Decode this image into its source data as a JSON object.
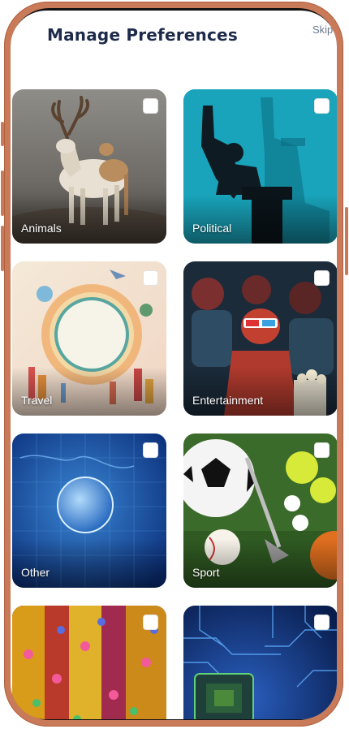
{
  "header": {
    "title": "Manage Preferences",
    "skip_label": "Skip"
  },
  "categories": [
    {
      "label": "Animals",
      "checked": false,
      "icon": "deer-photo"
    },
    {
      "label": "Political",
      "checked": false,
      "icon": "politician-podium-photo"
    },
    {
      "label": "Travel",
      "checked": false,
      "icon": "world-landmarks-photo"
    },
    {
      "label": "Entertainment",
      "checked": false,
      "icon": "cinema-audience-photo"
    },
    {
      "label": "Other",
      "checked": false,
      "icon": "globe-map-photo"
    },
    {
      "label": "Sport",
      "checked": false,
      "icon": "sports-balls-photo"
    },
    {
      "label": "",
      "checked": false,
      "icon": "festival-decor-photo"
    },
    {
      "label": "",
      "checked": false,
      "icon": "circuit-chip-photo"
    }
  ],
  "colors": {
    "title": "#1d2a4a",
    "frame": "#c97a59",
    "skip": "#6b7a8f"
  }
}
